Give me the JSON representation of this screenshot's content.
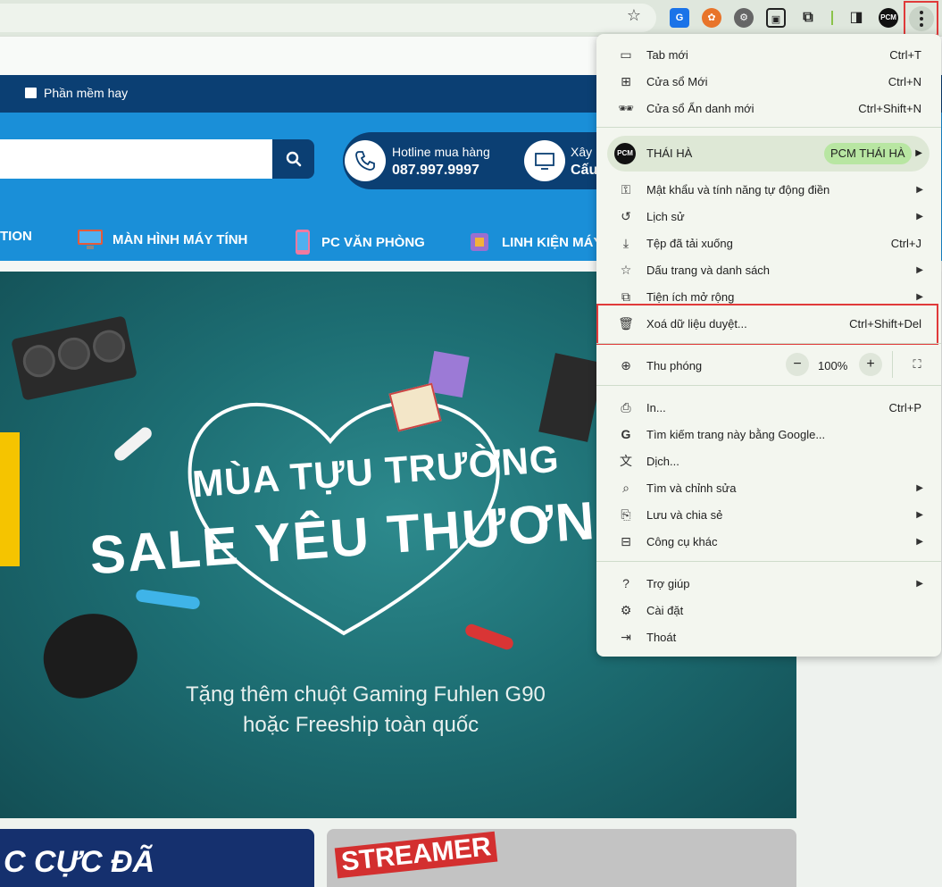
{
  "page": {
    "top_menu_item": "Phần mềm hay",
    "hotline_label": "Hotline mua hàng",
    "hotline_number": "087.997.9997",
    "build_label": "Xây",
    "build_sub": "Cấu",
    "nav": [
      "TION",
      "MÀN HÌNH MÁY TÍNH",
      "PC VĂN PHÒNG",
      "LINH KIỆN MÁY T"
    ],
    "banner": {
      "title1": "MÙA TỰU TRƯỜNG",
      "title2": "SALE YÊU THƯƠNG",
      "sub1": "Tặng thêm chuột Gaming Fuhlen G90",
      "sub2": "hoặc Freeship toàn quốc"
    },
    "tile1_text": "C CỰC ĐÃ",
    "tile2_text": "STREAMER"
  },
  "toolbar": {
    "profile_badge": "PCM"
  },
  "menu": {
    "items_top": [
      {
        "label": "Tab mới",
        "shortcut": "Ctrl+T",
        "icon": "tab-icon"
      },
      {
        "label": "Cửa sổ Mới",
        "shortcut": "Ctrl+N",
        "icon": "new-window-icon"
      },
      {
        "label": "Cửa sổ Ẩn danh mới",
        "shortcut": "Ctrl+Shift+N",
        "icon": "incognito-icon"
      }
    ],
    "profile": {
      "name": "THÁI HÀ",
      "chip": "PCM THÁI HÀ",
      "avatar": "PCM"
    },
    "items_mid": [
      {
        "label": "Mật khẩu và tính năng tự động điền",
        "icon": "key-icon",
        "submenu": true
      },
      {
        "label": "Lịch sử",
        "icon": "history-icon",
        "submenu": true
      },
      {
        "label": "Tệp đã tải xuống",
        "shortcut": "Ctrl+J",
        "icon": "download-icon"
      },
      {
        "label": "Dấu trang và danh sách",
        "icon": "bookmark-star-icon",
        "submenu": true
      },
      {
        "label": "Tiện ích mở rộng",
        "icon": "extension-icon",
        "submenu": true
      },
      {
        "label": "Xoá dữ liệu duyệt...",
        "shortcut": "Ctrl+Shift+Del",
        "icon": "trash-icon"
      }
    ],
    "zoom": {
      "label": "Thu phóng",
      "value": "100%",
      "minus": "−",
      "plus": "+"
    },
    "items_tools": [
      {
        "label": "In...",
        "shortcut": "Ctrl+P",
        "icon": "print-icon"
      },
      {
        "label": "Tìm kiếm trang này bằng Google...",
        "icon": "google-icon"
      },
      {
        "label": "Dịch...",
        "icon": "translate-icon"
      },
      {
        "label": "Tìm và chỉnh sửa",
        "icon": "find-icon",
        "submenu": true
      },
      {
        "label": "Lưu và chia sẻ",
        "icon": "save-share-icon",
        "submenu": true
      },
      {
        "label": "Công cụ khác",
        "icon": "toolbox-icon",
        "submenu": true
      }
    ],
    "items_bottom": [
      {
        "label": "Trợ giúp",
        "icon": "help-icon",
        "submenu": true
      },
      {
        "label": "Cài đặt",
        "icon": "settings-gear-icon"
      },
      {
        "label": "Thoát",
        "icon": "exit-icon"
      }
    ]
  },
  "colors": {
    "highlight": "#e03a3a",
    "site_blue": "#1a8fd8",
    "site_navy": "#0b3f73",
    "menu_bg": "#f3f6ef",
    "chip_green": "#b8e6a2"
  }
}
